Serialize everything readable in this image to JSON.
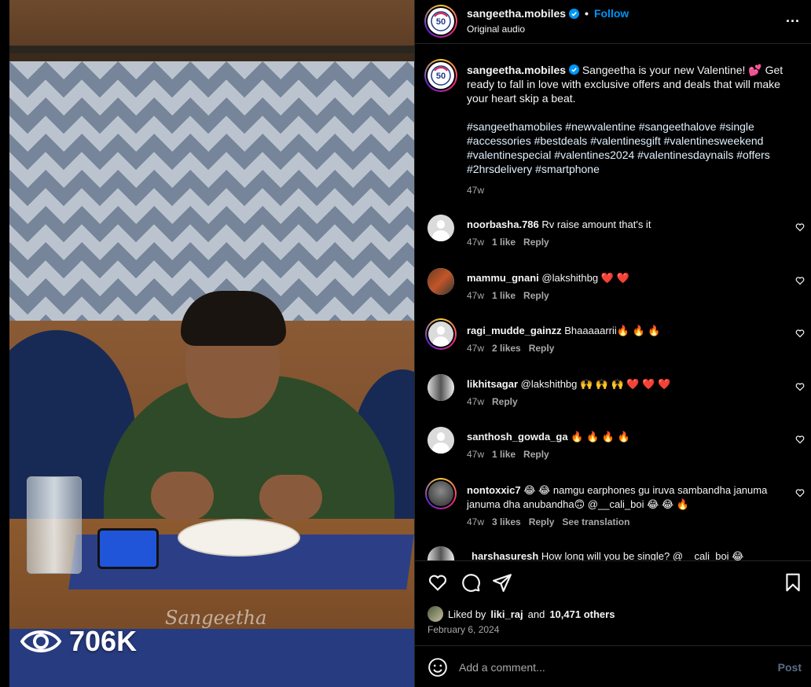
{
  "media": {
    "watermark": "Sangeetha",
    "views": "706K"
  },
  "post": {
    "username": "sangeetha.mobiles",
    "follow_label": "Follow",
    "separator": "•",
    "audio": "Original audio",
    "more": "..."
  },
  "caption": {
    "username": "sangeetha.mobiles",
    "text": "Sangeetha is your new Valentine! 💕 Get ready to fall in love with exclusive offers and deals that will make your heart skip a beat.",
    "hashtags": "#sangeethamobiles #newvalentine #sangeethalove #single #accessories #bestdeals #valentinesgift #valentinesweekend #valentinespecial #valentines2024 #valentinesdaynails #offers #2hrsdelivery #smartphone",
    "time": "47w"
  },
  "comments": [
    {
      "user": "noorbasha.786",
      "text": "Rv raise amount that's it",
      "time": "47w",
      "likes": "1 like",
      "reply": "Reply"
    },
    {
      "user": "mammu_gnani",
      "text": "@lakshithbg ❤️ ❤️",
      "time": "47w",
      "likes": "1 like",
      "reply": "Reply"
    },
    {
      "user": "ragi_mudde_gainzz",
      "text": "Bhaaaaarrii🔥 🔥 🔥",
      "time": "47w",
      "likes": "2 likes",
      "reply": "Reply"
    },
    {
      "user": "likhitsagar",
      "text": "@lakshithbg 🙌 🙌 🙌 ❤️ ❤️ ❤️",
      "time": "47w",
      "likes": "",
      "reply": "Reply"
    },
    {
      "user": "santhosh_gowda_ga",
      "text": "🔥 🔥 🔥 🔥",
      "time": "47w",
      "likes": "1 like",
      "reply": "Reply"
    },
    {
      "user": "nontoxxic7",
      "text": "😂 😂 namgu earphones gu iruva sambandha januma januma dha anubandha🙃 @__cali_boi 😂 😂 🔥",
      "time": "47w",
      "likes": "3 likes",
      "reply": "Reply",
      "translate": "See translation"
    },
    {
      "user": "harshasuresh",
      "text": "How long will you be single? @__cali_boi 😂"
    }
  ],
  "likes": {
    "prefix": "Liked by",
    "user": "liki_raj",
    "and": "and",
    "count": "10,471 others",
    "date": "February 6, 2024"
  },
  "composer": {
    "placeholder": "Add a comment...",
    "post_label": "Post"
  },
  "colors": {
    "accent": "#0095f6",
    "background": "#000000",
    "muted": "#a8a8a8"
  }
}
